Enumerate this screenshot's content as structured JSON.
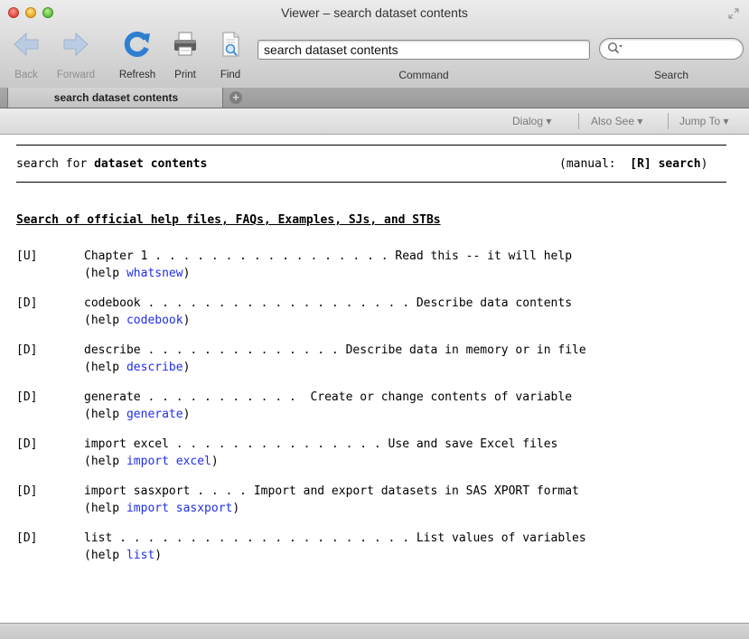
{
  "window": {
    "title": "Viewer – search dataset contents"
  },
  "toolbar": {
    "back_label": "Back",
    "forward_label": "Forward",
    "refresh_label": "Refresh",
    "print_label": "Print",
    "find_label": "Find",
    "command_value": "search dataset contents",
    "command_label": "Command",
    "search_label": "Search",
    "search_value": "",
    "icons": [
      "back-arrow-icon",
      "forward-arrow-icon",
      "refresh-icon",
      "printer-icon",
      "find-document-icon",
      "search-icon"
    ]
  },
  "tabs": [
    {
      "label": "search dataset contents",
      "active": true
    }
  ],
  "subbar": {
    "dialog_label": "Dialog ▾",
    "also_see_label": "Also See ▾",
    "jump_to_label": "Jump To ▾"
  },
  "content": {
    "header": {
      "prefix": "search for ",
      "term": "dataset contents",
      "manual_prefix": "(manual:  ",
      "manual_ref": "[R] search",
      "manual_suffix": ")"
    },
    "section_title": "Search of official help files, FAQs, Examples, SJs, and STBs",
    "entries": [
      {
        "tag": "[U]",
        "line": "Chapter 1 . . . . . . . . . . . . . . . . . Read this -- it will help",
        "help_prefix": "(help ",
        "help_link": "whatsnew",
        "help_suffix": ")"
      },
      {
        "tag": "[D]",
        "line": "codebook . . . . . . . . . . . . . . . . . . . Describe data contents",
        "help_prefix": "(help ",
        "help_link": "codebook",
        "help_suffix": ")"
      },
      {
        "tag": "[D]",
        "line": "describe . . . . . . . . . . . . . . Describe data in memory or in file",
        "help_prefix": "(help ",
        "help_link": "describe",
        "help_suffix": ")"
      },
      {
        "tag": "[D]",
        "line": "generate . . . . . . . . . . .  Create or change contents of variable",
        "help_prefix": "(help ",
        "help_link": "generate",
        "help_suffix": ")"
      },
      {
        "tag": "[D]",
        "line": "import excel . . . . . . . . . . . . . . . Use and save Excel files",
        "help_prefix": "(help ",
        "help_link": "import excel",
        "help_suffix": ")"
      },
      {
        "tag": "[D]",
        "line": "import sasxport . . . . Import and export datasets in SAS XPORT format",
        "help_prefix": "(help ",
        "help_link": "import sasxport",
        "help_suffix": ")"
      },
      {
        "tag": "[D]",
        "line": "list . . . . . . . . . . . . . . . . . . . . . List values of variables",
        "help_prefix": "(help ",
        "help_link": "list",
        "help_suffix": ")"
      }
    ]
  },
  "colors": {
    "link": "#1f2ee8",
    "accent_blue": "#3c8ad8",
    "toolbar_bg": "#d6d6d6"
  }
}
